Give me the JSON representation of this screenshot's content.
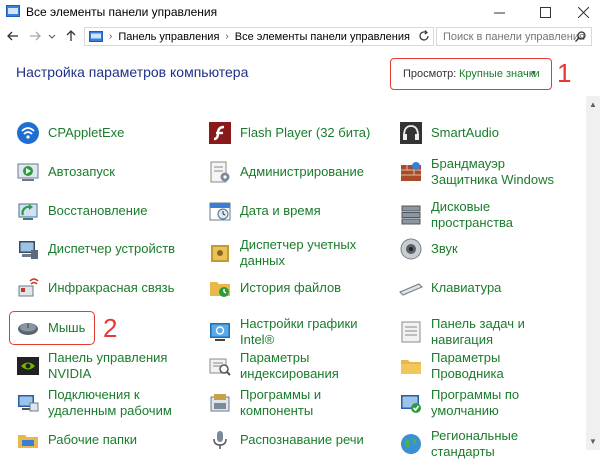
{
  "window": {
    "title": "Все элементы панели управления"
  },
  "address": {
    "crumbs": [
      "Панель управления",
      "Все элементы панели управления"
    ]
  },
  "search": {
    "placeholder": "Поиск в панели управления"
  },
  "heading": "Настройка параметров компьютера",
  "view": {
    "label": "Просмотр:",
    "value": "Крупные значки"
  },
  "annotations": {
    "marker1": "1",
    "marker2": "2"
  },
  "items": {
    "col1": [
      {
        "label": "CPAppletExe",
        "icon": "wireless-icon"
      },
      {
        "label": "Автозапуск",
        "icon": "autoplay-icon"
      },
      {
        "label": "Восстановление",
        "icon": "recovery-icon"
      },
      {
        "label": "Диспетчер устройств",
        "icon": "device-manager-icon"
      },
      {
        "label": "Инфракрасная связь",
        "icon": "infrared-icon"
      },
      {
        "label": "Мышь",
        "icon": "mouse-icon"
      },
      {
        "label": "Панель управления NVIDIA",
        "icon": "nvidia-icon"
      },
      {
        "label": "Подключения к удаленным рабочим",
        "icon": "remote-desktop-icon"
      },
      {
        "label": "Рабочие папки",
        "icon": "work-folders-icon"
      }
    ],
    "col2": [
      {
        "label": "Flash Player (32 бита)",
        "icon": "flash-icon"
      },
      {
        "label": "Администрирование",
        "icon": "admin-tools-icon"
      },
      {
        "label": "Дата и время",
        "icon": "date-time-icon"
      },
      {
        "label": "Диспетчер учетных данных",
        "icon": "credential-manager-icon"
      },
      {
        "label": "История файлов",
        "icon": "file-history-icon"
      },
      {
        "label": "Настройки графики Intel®",
        "icon": "intel-graphics-icon"
      },
      {
        "label": "Параметры индексирования",
        "icon": "indexing-icon"
      },
      {
        "label": "Программы и компоненты",
        "icon": "programs-icon"
      },
      {
        "label": "Распознавание речи",
        "icon": "speech-icon"
      }
    ],
    "col3": [
      {
        "label": "SmartAudio",
        "icon": "headphones-icon"
      },
      {
        "label": "Брандмауэр Защитника Windows",
        "icon": "firewall-icon"
      },
      {
        "label": "Дисковые пространства",
        "icon": "storage-spaces-icon"
      },
      {
        "label": "Звук",
        "icon": "speaker-icon"
      },
      {
        "label": "Клавиатура",
        "icon": "keyboard-icon"
      },
      {
        "label": "Панель задач и навигация",
        "icon": "taskbar-icon"
      },
      {
        "label": "Параметры Проводника",
        "icon": "folder-options-icon"
      },
      {
        "label": "Программы по умолчанию",
        "icon": "default-programs-icon"
      },
      {
        "label": "Региональные стандарты",
        "icon": "region-icon"
      }
    ]
  }
}
